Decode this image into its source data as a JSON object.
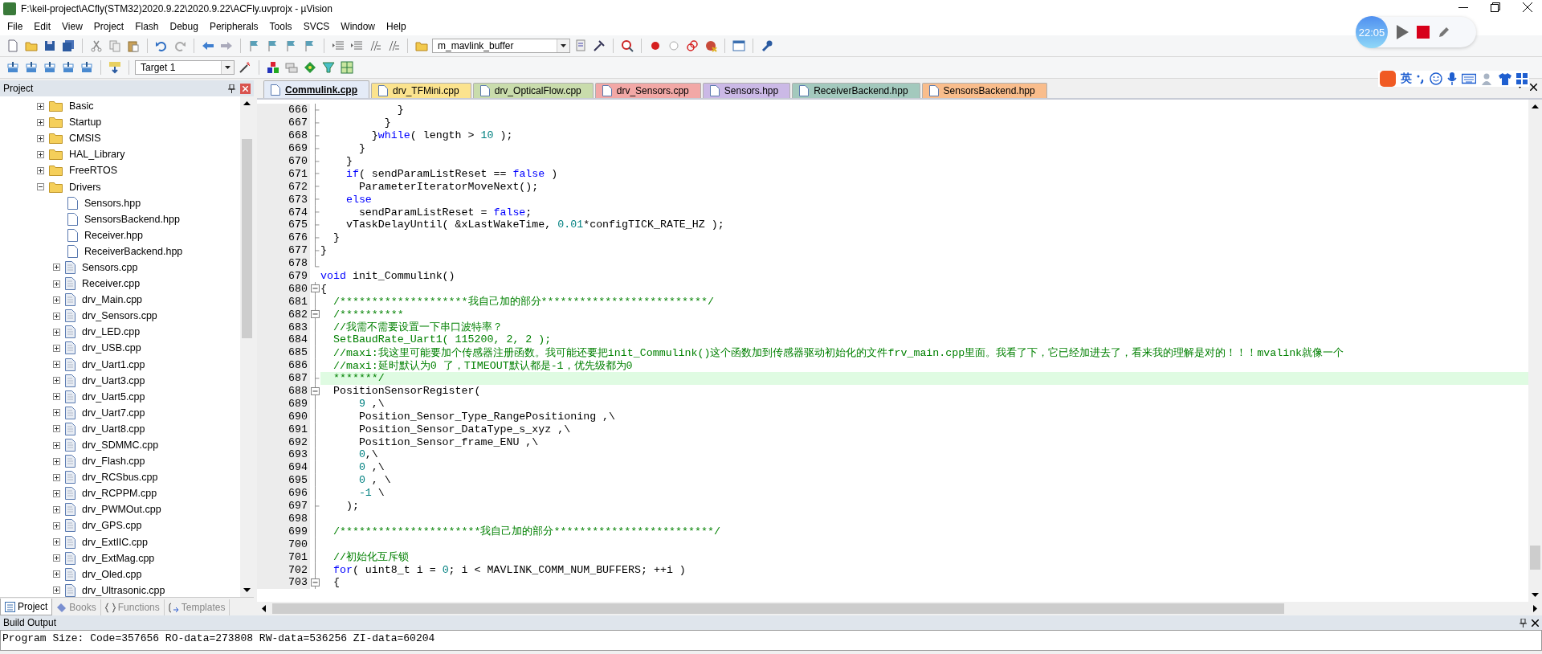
{
  "window": {
    "title": "F:\\keil-project\\ACfly(STM32)2020.9.22\\2020.9.22\\ACFly.uvprojx - µVision"
  },
  "menu": [
    "File",
    "Edit",
    "View",
    "Project",
    "Flash",
    "Debug",
    "Peripherals",
    "Tools",
    "SVCS",
    "Window",
    "Help"
  ],
  "toolbar": {
    "find_combo": "m_mavlink_buffer",
    "target_combo": "Target 1"
  },
  "recorder": {
    "time": "22:05"
  },
  "ime": {
    "mode": "英"
  },
  "project_panel": {
    "title": "Project",
    "tree": [
      {
        "name": "Basic",
        "kind": "folder",
        "expanded": false
      },
      {
        "name": "Startup",
        "kind": "folder",
        "expanded": false
      },
      {
        "name": "CMSIS",
        "kind": "folder",
        "expanded": false
      },
      {
        "name": "HAL_Library",
        "kind": "folder",
        "expanded": false
      },
      {
        "name": "FreeRTOS",
        "kind": "folder",
        "expanded": false
      },
      {
        "name": "Drivers",
        "kind": "folder",
        "expanded": true,
        "children": [
          {
            "name": "Sensors.hpp",
            "kind": "header"
          },
          {
            "name": "SensorsBackend.hpp",
            "kind": "header"
          },
          {
            "name": "Receiver.hpp",
            "kind": "header"
          },
          {
            "name": "ReceiverBackend.hpp",
            "kind": "header"
          },
          {
            "name": "Sensors.cpp",
            "kind": "source",
            "expanded": false
          },
          {
            "name": "Receiver.cpp",
            "kind": "source",
            "expanded": false
          },
          {
            "name": "drv_Main.cpp",
            "kind": "source",
            "expanded": false
          },
          {
            "name": "drv_Sensors.cpp",
            "kind": "source",
            "expanded": false
          },
          {
            "name": "drv_LED.cpp",
            "kind": "source",
            "expanded": false
          },
          {
            "name": "drv_USB.cpp",
            "kind": "source",
            "expanded": false
          },
          {
            "name": "drv_Uart1.cpp",
            "kind": "source",
            "expanded": false
          },
          {
            "name": "drv_Uart3.cpp",
            "kind": "source",
            "expanded": false
          },
          {
            "name": "drv_Uart5.cpp",
            "kind": "source",
            "expanded": false
          },
          {
            "name": "drv_Uart7.cpp",
            "kind": "source",
            "expanded": false
          },
          {
            "name": "drv_Uart8.cpp",
            "kind": "source",
            "expanded": false
          },
          {
            "name": "drv_SDMMC.cpp",
            "kind": "source",
            "expanded": false
          },
          {
            "name": "drv_Flash.cpp",
            "kind": "source",
            "expanded": false
          },
          {
            "name": "drv_RCSbus.cpp",
            "kind": "source",
            "expanded": false
          },
          {
            "name": "drv_RCPPM.cpp",
            "kind": "source",
            "expanded": false
          },
          {
            "name": "drv_PWMOut.cpp",
            "kind": "source",
            "expanded": false
          },
          {
            "name": "drv_GPS.cpp",
            "kind": "source",
            "expanded": false
          },
          {
            "name": "drv_ExtIIC.cpp",
            "kind": "source",
            "expanded": false
          },
          {
            "name": "drv_ExtMag.cpp",
            "kind": "source",
            "expanded": false
          },
          {
            "name": "drv_Oled.cpp",
            "kind": "source",
            "expanded": false
          },
          {
            "name": "drv_Ultrasonic.cpp",
            "kind": "source",
            "expanded": false
          }
        ]
      }
    ],
    "tabs": [
      {
        "label": "Project",
        "selected": true
      },
      {
        "label": "Books",
        "selected": false
      },
      {
        "label": "Functions",
        "selected": false
      },
      {
        "label": "Templates",
        "selected": false
      }
    ]
  },
  "editor": {
    "tabs": [
      {
        "label": "Commulink.cpp",
        "color": "#e4ebf7",
        "selected": true
      },
      {
        "label": "drv_TFMini.cpp",
        "color": "#fbe38e",
        "selected": false
      },
      {
        "label": "drv_OpticalFlow.cpp",
        "color": "#c9dcac",
        "selected": false
      },
      {
        "label": "drv_Sensors.cpp",
        "color": "#f2a8a6",
        "selected": false
      },
      {
        "label": "Sensors.hpp",
        "color": "#cbb9e6",
        "selected": false
      },
      {
        "label": "ReceiverBackend.hpp",
        "color": "#a3c9bd",
        "selected": false
      },
      {
        "label": "SensorsBackend.hpp",
        "color": "#f9bd8c",
        "selected": false
      }
    ],
    "lines": [
      {
        "number": "666",
        "kind": "tick",
        "highlighted": false,
        "segments": [
          {
            "text": "            }",
            "kind": "plain"
          }
        ]
      },
      {
        "number": "667",
        "kind": "tick",
        "highlighted": false,
        "segments": [
          {
            "text": "          }",
            "kind": "plain"
          }
        ]
      },
      {
        "number": "668",
        "kind": "tick",
        "highlighted": false,
        "segments": [
          {
            "text": "        }",
            "kind": "plain"
          },
          {
            "text": "while",
            "kind": "keyword"
          },
          {
            "text": "( length > ",
            "kind": "plain"
          },
          {
            "text": "10",
            "kind": "number"
          },
          {
            "text": " );",
            "kind": "plain"
          }
        ]
      },
      {
        "number": "669",
        "kind": "tick",
        "highlighted": false,
        "segments": [
          {
            "text": "      }",
            "kind": "plain"
          }
        ]
      },
      {
        "number": "670",
        "kind": "tick",
        "highlighted": false,
        "segments": [
          {
            "text": "    }",
            "kind": "plain"
          }
        ]
      },
      {
        "number": "671",
        "kind": "tick",
        "highlighted": false,
        "segments": [
          {
            "text": "    if",
            "kind": "keyword"
          },
          {
            "text": "( sendParamListReset == ",
            "kind": "plain"
          },
          {
            "text": "false",
            "kind": "keyword"
          },
          {
            "text": " )",
            "kind": "plain"
          }
        ]
      },
      {
        "number": "672",
        "kind": "tick",
        "highlighted": false,
        "segments": [
          {
            "text": "      ParameterIteratorMoveNext();",
            "kind": "plain"
          }
        ]
      },
      {
        "number": "673",
        "kind": "tick",
        "highlighted": false,
        "segments": [
          {
            "text": "    else",
            "kind": "keyword"
          }
        ]
      },
      {
        "number": "674",
        "kind": "tick",
        "highlighted": false,
        "segments": [
          {
            "text": "      sendParamListReset = ",
            "kind": "plain"
          },
          {
            "text": "false",
            "kind": "keyword"
          },
          {
            "text": ";",
            "kind": "plain"
          }
        ]
      },
      {
        "number": "675",
        "kind": "tick",
        "highlighted": false,
        "segments": [
          {
            "text": "    vTaskDelayUntil( &xLastWakeTime, ",
            "kind": "plain"
          },
          {
            "text": "0.01",
            "kind": "number"
          },
          {
            "text": "*configTICK_RATE_HZ );",
            "kind": "plain"
          }
        ]
      },
      {
        "number": "676",
        "kind": "tick",
        "highlighted": false,
        "segments": [
          {
            "text": "  }",
            "kind": "plain"
          }
        ]
      },
      {
        "number": "677",
        "kind": "tick",
        "highlighted": false,
        "segments": [
          {
            "text": "}",
            "kind": "plain"
          }
        ]
      },
      {
        "number": "678",
        "kind": "end",
        "highlighted": false
      },
      {
        "number": "679",
        "kind": "none",
        "highlighted": false,
        "segments": [
          {
            "text": "void",
            "kind": "keyword"
          },
          {
            "text": " init_Commulink()",
            "kind": "plain"
          }
        ]
      },
      {
        "number": "680",
        "kind": "box",
        "highlighted": false,
        "segments": [
          {
            "text": "{",
            "kind": "plain"
          }
        ]
      },
      {
        "number": "681",
        "kind": "line",
        "highlighted": false,
        "segments": [
          {
            "text": "  /********************我自己加的部分**************************/",
            "kind": "comment"
          }
        ]
      },
      {
        "number": "682",
        "kind": "box",
        "highlighted": false,
        "segments": [
          {
            "text": "  /**********",
            "kind": "comment"
          }
        ]
      },
      {
        "number": "683",
        "kind": "line",
        "highlighted": false,
        "segments": [
          {
            "text": "  //我需不需要设置一下串口波特率？",
            "kind": "comment"
          }
        ]
      },
      {
        "number": "684",
        "kind": "line",
        "highlighted": false,
        "segments": [
          {
            "text": "  SetBaudRate_Uart1( 115200, 2, 2 );",
            "kind": "comment"
          }
        ]
      },
      {
        "number": "685",
        "kind": "line",
        "highlighted": false,
        "segments": [
          {
            "text": "  //maxi:我这里可能要加个传感器注册函数。我可能还要把init_Commulink()这个函数加到传感器驱动初始化的文件frv_main.cpp里面。我看了下，它已经加进去了，看来我的理解是对的！！！mvalink就像一个",
            "kind": "comment"
          }
        ]
      },
      {
        "number": "686",
        "kind": "line",
        "highlighted": false,
        "segments": [
          {
            "text": "  //maxi:延时默认为0 了，TIMEOUT默认都是-1，优先级都为0",
            "kind": "comment"
          }
        ]
      },
      {
        "number": "687",
        "kind": "tick",
        "highlighted": true,
        "segments": [
          {
            "text": "  *******/",
            "kind": "comment"
          }
        ]
      },
      {
        "number": "688",
        "kind": "box",
        "highlighted": false,
        "segments": [
          {
            "text": "  PositionSensorRegister(",
            "kind": "plain"
          }
        ]
      },
      {
        "number": "689",
        "kind": "line",
        "highlighted": false,
        "segments": [
          {
            "text": "      9",
            "kind": "number"
          },
          {
            "text": " ,\\",
            "kind": "plain"
          }
        ]
      },
      {
        "number": "690",
        "kind": "line",
        "highlighted": false,
        "segments": [
          {
            "text": "      Position_Sensor_Type_RangePositioning ,\\",
            "kind": "plain"
          }
        ]
      },
      {
        "number": "691",
        "kind": "line",
        "highlighted": false,
        "segments": [
          {
            "text": "      Position_Sensor_DataType_s_xyz ,\\",
            "kind": "plain"
          }
        ]
      },
      {
        "number": "692",
        "kind": "line",
        "highlighted": false,
        "segments": [
          {
            "text": "      Position_Sensor_frame_ENU ,\\",
            "kind": "plain"
          }
        ]
      },
      {
        "number": "693",
        "kind": "line",
        "highlighted": false,
        "segments": [
          {
            "text": "      0",
            "kind": "number"
          },
          {
            "text": ",\\",
            "kind": "plain"
          }
        ]
      },
      {
        "number": "694",
        "kind": "line",
        "highlighted": false,
        "segments": [
          {
            "text": "      0",
            "kind": "number"
          },
          {
            "text": " ,\\",
            "kind": "plain"
          }
        ]
      },
      {
        "number": "695",
        "kind": "line",
        "highlighted": false,
        "segments": [
          {
            "text": "      0",
            "kind": "number"
          },
          {
            "text": " , \\",
            "kind": "plain"
          }
        ]
      },
      {
        "number": "696",
        "kind": "line",
        "highlighted": false,
        "segments": [
          {
            "text": "      -1",
            "kind": "number"
          },
          {
            "text": " \\",
            "kind": "plain"
          }
        ]
      },
      {
        "number": "697",
        "kind": "tick",
        "highlighted": false,
        "segments": [
          {
            "text": "    );",
            "kind": "plain"
          }
        ]
      },
      {
        "number": "698",
        "kind": "line",
        "highlighted": false
      },
      {
        "number": "699",
        "kind": "line",
        "highlighted": false,
        "segments": [
          {
            "text": "  /**********************我自己加的部分*************************/",
            "kind": "comment"
          }
        ]
      },
      {
        "number": "700",
        "kind": "line",
        "highlighted": false
      },
      {
        "number": "701",
        "kind": "line",
        "highlighted": false,
        "segments": [
          {
            "text": "  //初始化互斥锁",
            "kind": "comment"
          }
        ]
      },
      {
        "number": "702",
        "kind": "line",
        "highlighted": false,
        "segments": [
          {
            "text": "  for",
            "kind": "keyword"
          },
          {
            "text": "( uint8_t i = ",
            "kind": "plain"
          },
          {
            "text": "0",
            "kind": "number"
          },
          {
            "text": "; i < MAVLINK_COMM_NUM_BUFFERS; ++i )",
            "kind": "plain"
          }
        ]
      },
      {
        "number": "703",
        "kind": "box",
        "highlighted": false,
        "segments": [
          {
            "text": "  {",
            "kind": "plain"
          }
        ]
      }
    ]
  },
  "build_output": {
    "title": "Build Output",
    "lines": [
      "Program Size: Code=357656 RO-data=273808 RW-data=536256 ZI-data=60204"
    ]
  }
}
